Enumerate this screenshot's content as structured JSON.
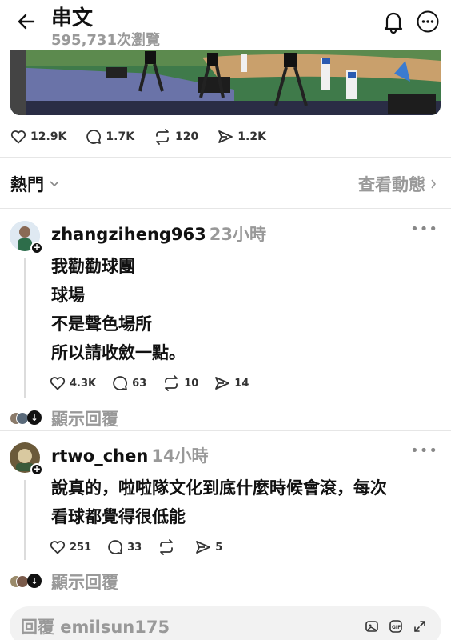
{
  "header": {
    "title": "串文",
    "views": "595,731次瀏覽"
  },
  "post_stats": {
    "likes": "12.9K",
    "comments": "1.7K",
    "reposts": "120",
    "shares": "1.2K"
  },
  "sort": {
    "label": "熱門",
    "activity_label": "查看動態"
  },
  "comments": [
    {
      "username": "zhangziheng963",
      "time": "23小時",
      "lines": [
        "我勸勸球團",
        "球場",
        "不是聲色場所",
        "所以請收斂一點。"
      ],
      "likes": "4.3K",
      "replies": "63",
      "reposts": "10",
      "shares": "14",
      "show_replies": "顯示回覆"
    },
    {
      "username": "rtwo_chen",
      "time": "14小時",
      "lines": [
        "說真的，啦啦隊文化到底什麼時候會滾，每次",
        "看球都覺得很低能"
      ],
      "likes": "251",
      "replies": "33",
      "reposts": "",
      "shares": "5",
      "show_replies": "顯示回覆"
    }
  ],
  "reply_bar": {
    "placeholder": "回覆 emilsun175"
  },
  "colors": {
    "text": "#111111",
    "muted": "#999999",
    "divider": "#e6e6e6",
    "reply_bg": "#f2f2f2"
  }
}
